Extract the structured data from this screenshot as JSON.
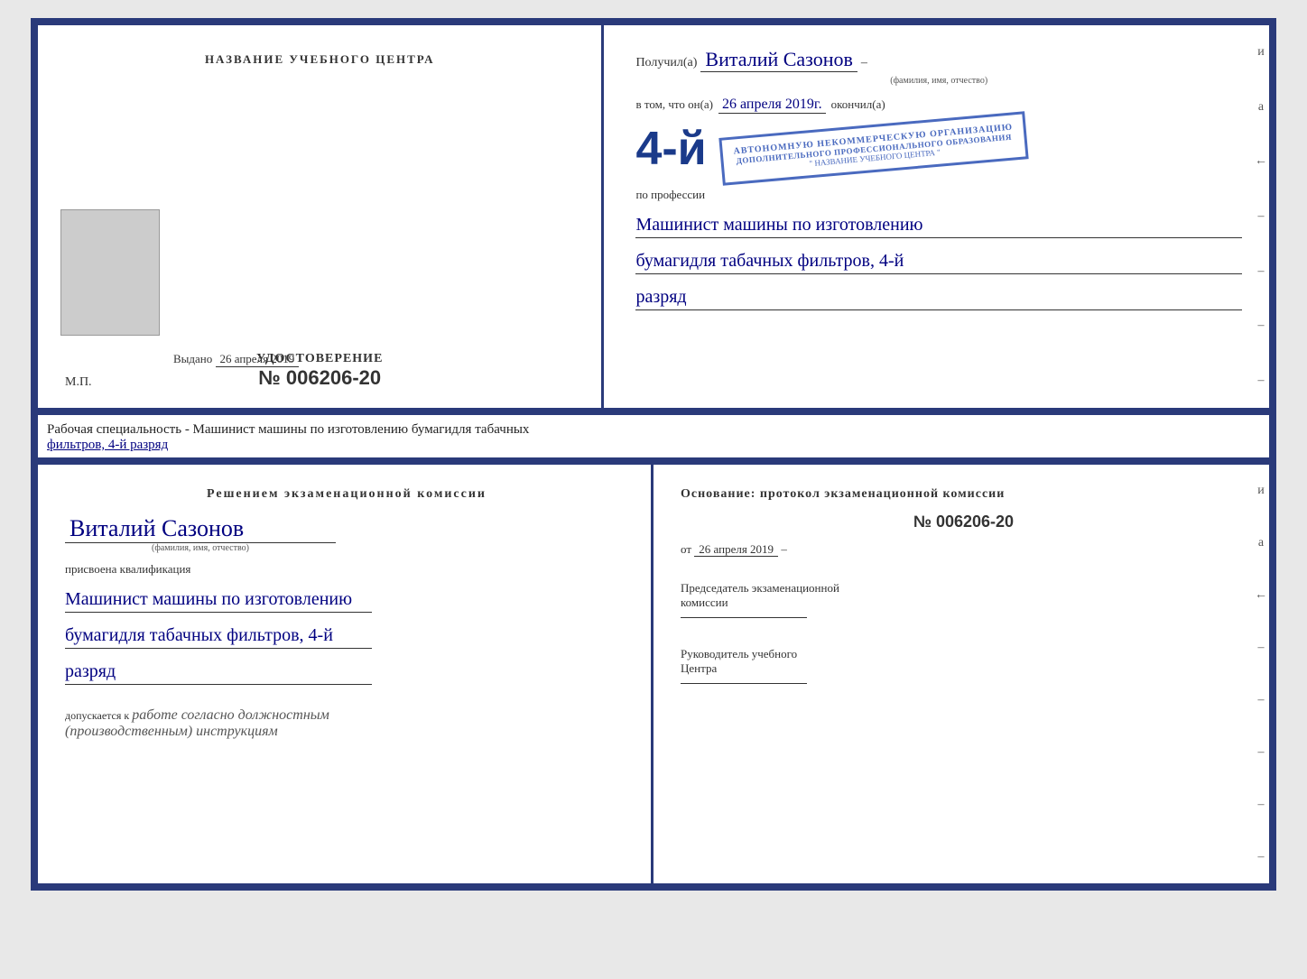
{
  "top_left": {
    "center_title": "НАЗВАНИЕ УЧЕБНОГО ЦЕНТРА",
    "udostoverenie_label": "УДОСТОВЕРЕНИЕ",
    "udost_number": "№ 006206-20",
    "vydano_label": "Выдано",
    "vydano_date": "26 апреля 2019",
    "mp_label": "М.П."
  },
  "top_right": {
    "poluchil_prefix": "Получил(а)",
    "recipient_name": "Виталий Сазонов",
    "fio_hint": "(фамилия, имя, отчество)",
    "vtom_prefix": "в том, что он(а)",
    "date_okончил": "26 апреля 2019г.",
    "okonchil_suffix": "окончил(а)",
    "big_number": "4-й",
    "stamp_line1": "АВТОНОМНУЮ НЕКОММЕРЧЕСКУЮ ОРГАНИЗАЦИЮ",
    "stamp_line2": "ДОПОЛНИТЕЛЬНОГО ПРОФЕССИОНАЛЬНОГО ОБРАЗОВАНИЯ",
    "stamp_line3": "\" НАЗВАНИЕ УЧЕБНОГО ЦЕНТРА \"",
    "po_professii": "по профессии",
    "profession_line1": "Машинист машины по изготовлению",
    "profession_line2": "бумагидля табачных фильтров, 4-й",
    "profession_line3": "разряд",
    "side_chars": [
      "и",
      "а",
      "←",
      "–",
      "–",
      "–",
      "–"
    ]
  },
  "specialty_label": {
    "prefix": "Рабочая специальность - Машинист машины по изготовлению бумагидля табачных",
    "underline_text": "фильтров, 4-й разряд"
  },
  "bottom_left": {
    "resheniem_title": "Решением  экзаменационной  комиссии",
    "name": "Виталий Сазонов",
    "fio_hint": "(фамилия, имя, отчество)",
    "prisvoena": "присвоена квалификация",
    "profession_line1": "Машинист машины по изготовлению",
    "profession_line2": "бумагидля табачных фильтров, 4-й",
    "profession_line3": "разряд",
    "dopuskaetsya_prefix": "допускается к",
    "dopuskaetsya_text": "работе согласно должностным",
    "dopuskaetsya_text2": "(производственным) инструкциям"
  },
  "bottom_right": {
    "osnovanie_text": "Основание:  протокол  экзаменационной  комиссии",
    "protocol_number": "№  006206-20",
    "ot_prefix": "от",
    "ot_date": "26 апреля 2019",
    "predsedatel_line1": "Председатель экзаменационной",
    "predsedatel_line2": "комиссии",
    "rukovoditel_line1": "Руководитель учебного",
    "rukovoditel_line2": "Центра",
    "side_chars": [
      "и",
      "а",
      "←",
      "–",
      "–",
      "–",
      "–",
      "–"
    ]
  }
}
